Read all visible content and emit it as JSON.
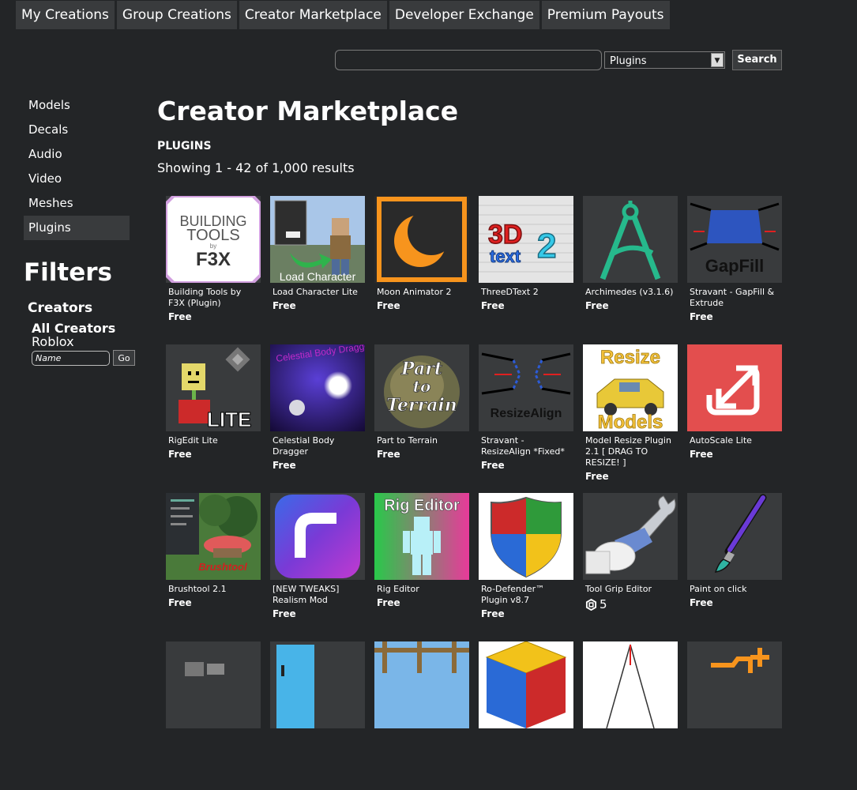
{
  "tabs": [
    "My Creations",
    "Group Creations",
    "Creator Marketplace",
    "Developer Exchange",
    "Premium Payouts"
  ],
  "search": {
    "value": "",
    "category": "Plugins",
    "button": "Search"
  },
  "sidebar": {
    "items": [
      "Models",
      "Decals",
      "Audio",
      "Video",
      "Meshes",
      "Plugins"
    ],
    "active": "Plugins"
  },
  "filters": {
    "title": "Filters",
    "creators_label": "Creators",
    "all_creators": "All Creators",
    "roblox": "Roblox",
    "name_placeholder": "Name",
    "go": "Go"
  },
  "main": {
    "title": "Creator Marketplace",
    "section": "PLUGINS",
    "results": "Showing 1 - 42 of 1,000 results"
  },
  "items": [
    {
      "name": "Building Tools by F3X (Plugin)",
      "price": "Free",
      "icon": "f3x-logo"
    },
    {
      "name": "Load Character Lite",
      "price": "Free",
      "icon": "load-character-thumb"
    },
    {
      "name": "Moon Animator 2",
      "price": "Free",
      "icon": "moon-logo"
    },
    {
      "name": "ThreeDText 2",
      "price": "Free",
      "icon": "3d-text-logo"
    },
    {
      "name": "Archimedes (v3.1.6)",
      "price": "Free",
      "icon": "compass-logo"
    },
    {
      "name": "Stravant - GapFill & Extrude",
      "price": "Free",
      "icon": "gapfill-logo"
    },
    {
      "name": "RigEdit Lite",
      "price": "Free",
      "icon": "rigedit-logo"
    },
    {
      "name": "Celestial Body Dragger",
      "price": "Free",
      "icon": "celestial-logo"
    },
    {
      "name": "Part to Terrain",
      "price": "Free",
      "icon": "terrain-logo"
    },
    {
      "name": "Stravant - ResizeAlign *Fixed*",
      "price": "Free",
      "icon": "resizealign-logo"
    },
    {
      "name": "Model Resize Plugin 2.1 [ DRAG TO RESIZE! ]",
      "price": "Free",
      "icon": "resize-models-logo"
    },
    {
      "name": "AutoScale Lite",
      "price": "Free",
      "icon": "autoscale-logo"
    },
    {
      "name": "Brushtool 2.1",
      "price": "Free",
      "icon": "brushtool-logo"
    },
    {
      "name": "[NEW TWEAKS] Realism Mod",
      "price": "Free",
      "icon": "realism-logo"
    },
    {
      "name": "Rig Editor",
      "price": "Free",
      "icon": "rig-editor-logo"
    },
    {
      "name": "Ro-Defender™ Plugin v8.7",
      "price": "Free",
      "icon": "shield-logo"
    },
    {
      "name": "Tool Grip Editor",
      "price": "5",
      "icon": "wrench-logo",
      "robux": true
    },
    {
      "name": "Paint on click",
      "price": "Free",
      "icon": "paintbrush-logo"
    }
  ],
  "thumb_labels": {
    "f3x_line1": "BUILDING",
    "f3x_line2": "TOOLS",
    "f3x_line3": "by",
    "f3x_line4": "F3X",
    "load_character": "Load Character",
    "threed_1": "3D",
    "threed_2": "2",
    "threed_3": "text",
    "gapfill": "GapFill",
    "lite": "LITE",
    "celestial": "Celestial Body Dragger",
    "terrain_1": "Part",
    "terrain_2": "to",
    "terrain_3": "Terrain",
    "resizealign": "ResizeAlign",
    "resize_1": "Resize",
    "resize_2": "Models",
    "brushtool": "Brushtool",
    "rig_editor": "Rig Editor"
  }
}
